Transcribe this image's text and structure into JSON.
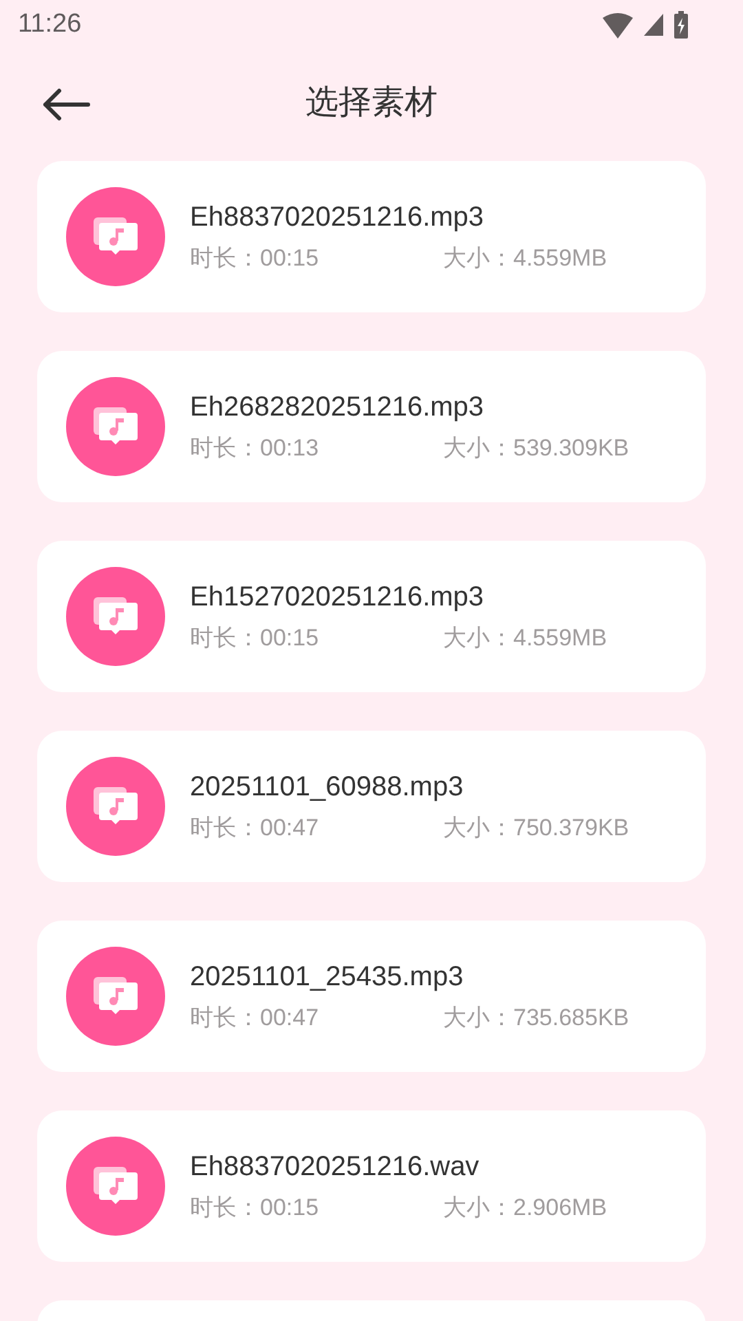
{
  "status_bar": {
    "time": "11:26"
  },
  "header": {
    "title": "选择素材"
  },
  "files": [
    {
      "name": "Eh8837020251216.mp3",
      "duration": "时长：00:15",
      "size": "大小：4.559MB"
    },
    {
      "name": "Eh2682820251216.mp3",
      "duration": "时长：00:13",
      "size": "大小：539.309KB"
    },
    {
      "name": "Eh1527020251216.mp3",
      "duration": "时长：00:15",
      "size": "大小：4.559MB"
    },
    {
      "name": "20251101_60988.mp3",
      "duration": "时长：00:47",
      "size": "大小：750.379KB"
    },
    {
      "name": "20251101_25435.mp3",
      "duration": "时长：00:47",
      "size": "大小：735.685KB"
    },
    {
      "name": "Eh8837020251216.wav",
      "duration": "时长：00:15",
      "size": "大小：2.906MB"
    }
  ]
}
